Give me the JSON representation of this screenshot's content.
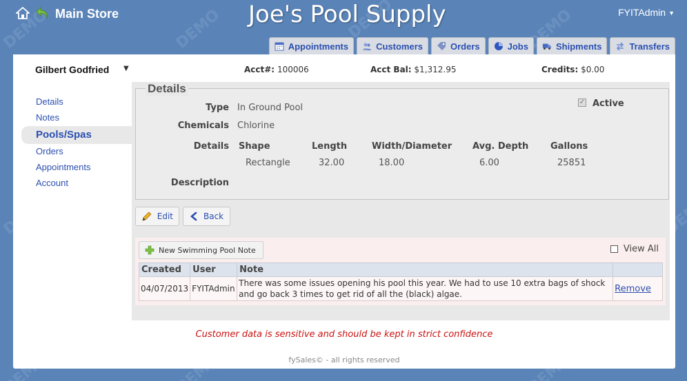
{
  "header": {
    "store_name": "Main Store",
    "app_title": "Joe's Pool Supply",
    "user": "FYITAdmin"
  },
  "tabs": [
    {
      "label": "Appointments",
      "icon": "calendar-icon"
    },
    {
      "label": "Customers",
      "icon": "users-icon"
    },
    {
      "label": "Orders",
      "icon": "tag-icon"
    },
    {
      "label": "Jobs",
      "icon": "pie-icon"
    },
    {
      "label": "Shipments",
      "icon": "truck-icon"
    },
    {
      "label": "Transfers",
      "icon": "arrows-icon"
    }
  ],
  "customer": {
    "name": "Gilbert Godfried",
    "acct_label": "Acct#:",
    "acct_value": "100006",
    "bal_label": "Acct Bal:",
    "bal_value": "$1,312.95",
    "credits_label": "Credits:",
    "credits_value": "$0.00"
  },
  "sidenav": {
    "items": [
      {
        "label": "Details"
      },
      {
        "label": "Notes"
      },
      {
        "label": "Pools/Spas"
      },
      {
        "label": "Orders"
      },
      {
        "label": "Appointments"
      },
      {
        "label": "Account"
      }
    ],
    "active": "Pools/Spas"
  },
  "details": {
    "legend": "Details",
    "type_label": "Type",
    "type_value": "In Ground Pool",
    "chemicals_label": "Chemicals",
    "chemicals_value": "Chlorine",
    "details_label": "Details",
    "description_label": "Description",
    "active_label": "Active",
    "active_checked": true,
    "columns": [
      "Shape",
      "Length",
      "Width/Diameter",
      "Avg. Depth",
      "Gallons"
    ],
    "row": [
      "Rectangle",
      "32.00",
      "18.00",
      "6.00",
      "25851"
    ]
  },
  "buttons": {
    "edit": "Edit",
    "back": "Back",
    "new_note": "New Swimming Pool Note",
    "view_all": "View All"
  },
  "notes": {
    "columns": [
      "Created",
      "User",
      "Note",
      ""
    ],
    "rows": [
      {
        "created": "04/07/2013",
        "user": "FYITAdmin",
        "note": "There was some issues opening his pool this year. We had to use 10 extra bags of shock and go back 3 times to get rid of all the (black) algae.",
        "action": "Remove"
      }
    ]
  },
  "disclaimer": "Customer data is sensitive and should be kept in strict confidence",
  "footer": "fySales© - all rights reserved",
  "watermark": "DEMO",
  "colors": {
    "background": "#5a84b8",
    "link": "#2b4fb0",
    "disclaimer": "#cc1111",
    "tab_bg": "#d9dde3"
  }
}
